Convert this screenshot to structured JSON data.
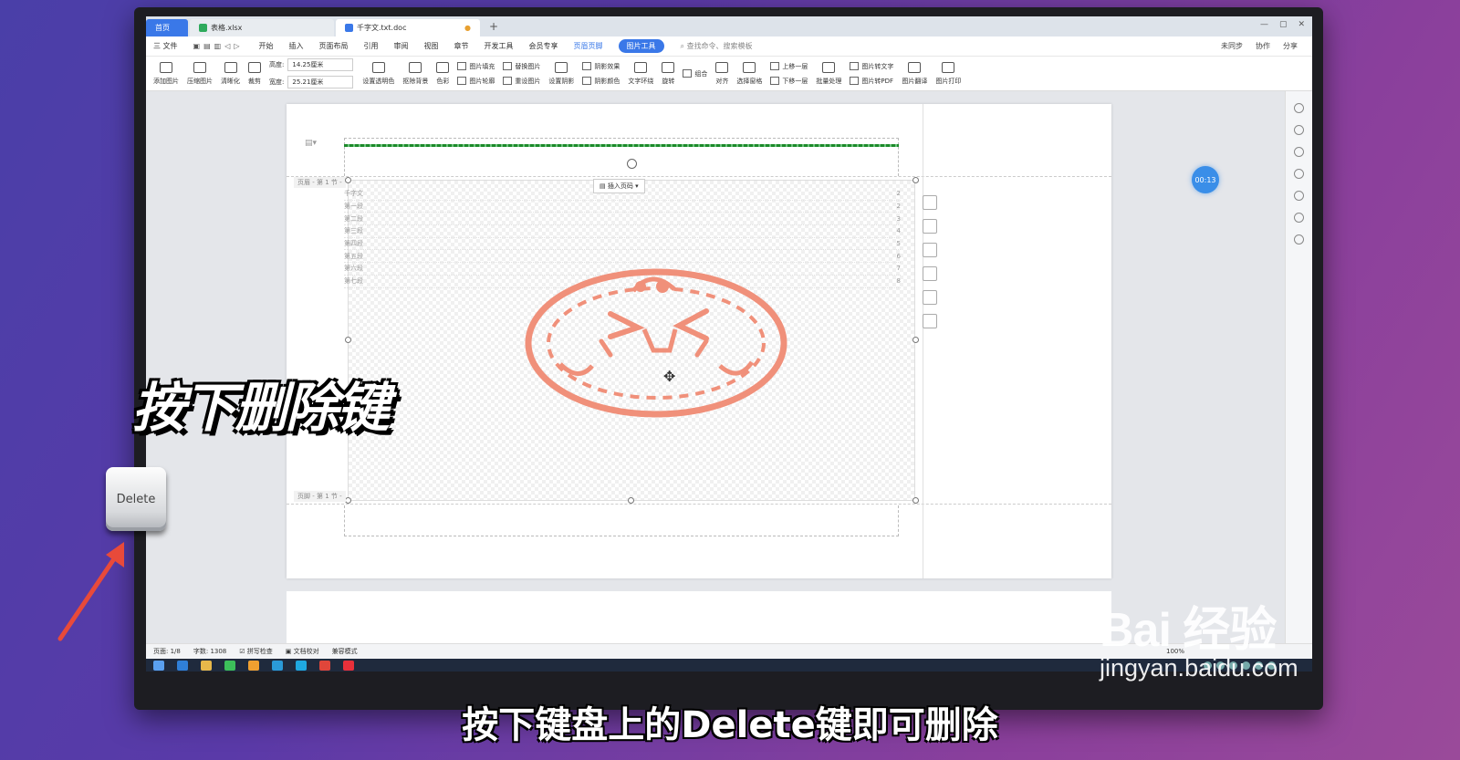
{
  "tabs": [
    {
      "label": "首页",
      "kind": "home"
    },
    {
      "label": "表格.xlsx",
      "kind": "file",
      "color": "#2eaa5c"
    },
    {
      "label": "千字文.txt.doc",
      "kind": "active",
      "color": "#3a78e8"
    }
  ],
  "menu": {
    "file": "三 文件",
    "items": [
      "开始",
      "插入",
      "页面布局",
      "引用",
      "审阅",
      "视图",
      "章节",
      "开发工具",
      "会员专享"
    ],
    "header_footer": "页眉页脚",
    "picture_tools": "图片工具",
    "search": "查找命令、搜索模板",
    "right": [
      "未同步",
      "协作",
      "分享"
    ]
  },
  "ribbon": {
    "add_picture": "添加图片",
    "compress": "压缩图片",
    "clarity": "清晰化",
    "crop": "裁剪",
    "height_label": "高度:",
    "height_value": "14.25厘米",
    "width_label": "宽度:",
    "width_value": "25.21厘米",
    "transparent": "设置透明色",
    "remove_bg": "抠除背景",
    "color": "色彩",
    "fill": "图片填充",
    "outline": "图片轮廓",
    "replace": "替换图片",
    "reset": "重设图片",
    "set_shadow": "设置阴影",
    "shadow_effect": "阴影效果",
    "shadow_color": "阴影颜色",
    "wrap": "文字环绕",
    "rotate": "旋转",
    "group": "组合",
    "align": "对齐",
    "select_pane": "选择窗格",
    "up_one": "上移一层",
    "down_one": "下移一层",
    "batch": "批量处理",
    "to_text": "图片转文字",
    "to_pdf": "图片转PDF",
    "translate": "图片翻译",
    "print": "图片打印"
  },
  "doc": {
    "header_label": "页眉 - 第 1 节 -",
    "footer_label": "页脚 - 第 1 节 -",
    "insert_page_number": "插入页码",
    "toc": [
      {
        "title": "千字文",
        "page": "2"
      },
      {
        "title": "第一段",
        "page": "2"
      },
      {
        "title": "第二段",
        "page": "3"
      },
      {
        "title": "第三段",
        "page": "4"
      },
      {
        "title": "第四段",
        "page": "5"
      },
      {
        "title": "第五段",
        "page": "6"
      },
      {
        "title": "第六段",
        "page": "7"
      },
      {
        "title": "第七段",
        "page": "8"
      }
    ]
  },
  "timer": "00:13",
  "status": {
    "page": "页面: 1/8",
    "words": "字数: 1308",
    "spell": "拼写检查",
    "proof": "文档校对",
    "compat": "兼容模式",
    "zoom": "100%"
  },
  "overlay": {
    "title": "按下删除键",
    "key_label": "Delete",
    "subtitle": "按下键盘上的Delete键即可删除"
  },
  "watermark": {
    "logo": "Bai 经验",
    "url": "jingyan.baidu.com"
  },
  "colors": {
    "accent": "#3a78e8",
    "stamp": "#f0907a",
    "arrow": "#e84a3a"
  }
}
